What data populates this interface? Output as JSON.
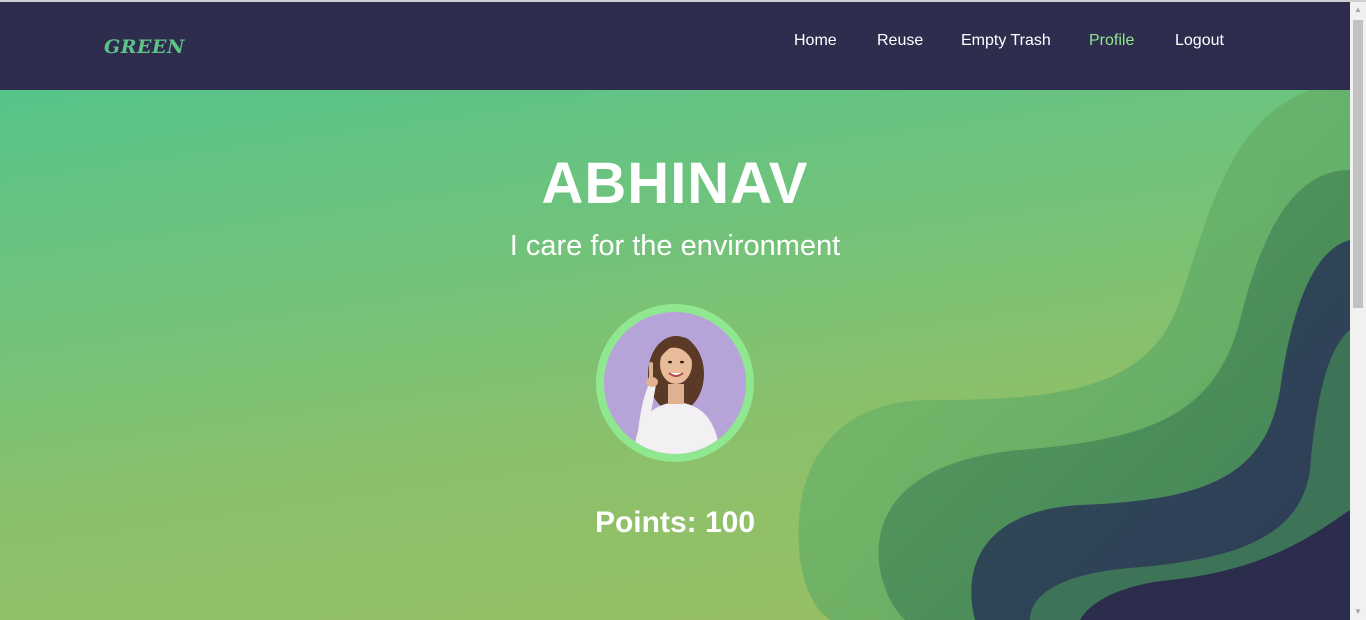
{
  "navbar": {
    "brand": "GREEN",
    "links": [
      {
        "label": "Home",
        "active": false
      },
      {
        "label": "Reuse",
        "active": false
      },
      {
        "label": "Empty Trash",
        "active": false
      },
      {
        "label": "Profile",
        "active": true
      },
      {
        "label": "Logout",
        "active": false
      }
    ]
  },
  "profile": {
    "name": "ABHINAV",
    "tagline": "I care for the environment",
    "avatar_icon": "user-photo",
    "points_label": "Points: 100"
  },
  "scrollbar": {
    "up_icon": "chevron-up-icon",
    "down_icon": "chevron-down-icon"
  },
  "colors": {
    "navbar_bg": "#2e2d4d",
    "brand": "#5fc389",
    "active_link": "#8fe88f",
    "avatar_ring": "#8fe88f",
    "hero_top": "#57c38a",
    "hero_bottom": "#9bbf62"
  }
}
